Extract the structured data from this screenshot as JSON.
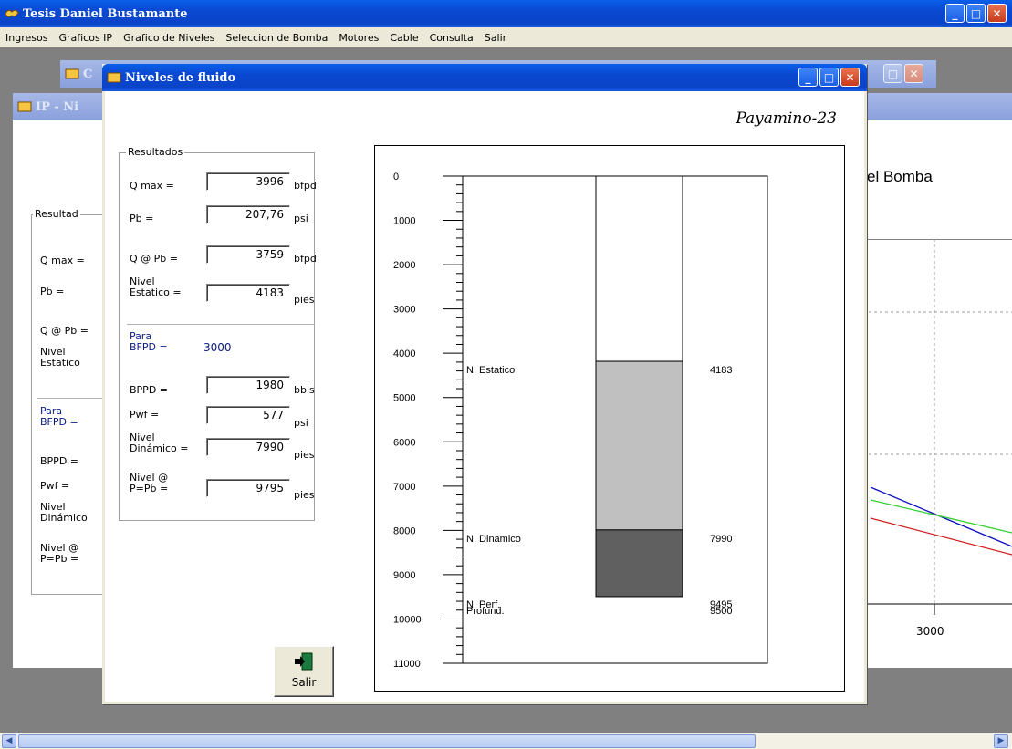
{
  "app": {
    "title": "Tesis Daniel Bustamante",
    "menu": [
      "Ingresos",
      "Graficos IP",
      "Grafico de Niveles",
      "Seleccion de Bomba",
      "Motores",
      "Cable",
      "Consulta",
      "Salir"
    ]
  },
  "bg_windows": {
    "win1_title": "C",
    "win2_title": "IP - Ni",
    "heading_fragment": "el Bomba",
    "axis_label_3000": "3000",
    "results_title": "Resultad",
    "labels": [
      "Q max =",
      "Pb =",
      "Q @ Pb =",
      "Nivel\nEstatico",
      "Para\nBFPD =",
      "BPPD =",
      "Pwf =",
      "Nivel\nDinámico",
      "Nivel @\nP=Pb ="
    ]
  },
  "dialog": {
    "title": "Niveles de fluido",
    "well_name": "Payamino-23",
    "results_title": "Resultados",
    "fields": {
      "qmax": {
        "label": "Q max =",
        "value": "3996",
        "unit": "bfpd"
      },
      "pb": {
        "label": "Pb =",
        "value": "207,76",
        "unit": "psi"
      },
      "qpb": {
        "label": "Q @ Pb =",
        "value": "3759",
        "unit": "bfpd"
      },
      "nivel_estatico": {
        "label_line1": "Nivel",
        "label_line2": "Estatico  =",
        "value": "4183",
        "unit": "pies"
      },
      "para_bfpd": {
        "label_line1": "Para",
        "label_line2": "BFPD  =",
        "value": "3000"
      },
      "bppd": {
        "label": "BPPD  =",
        "value": "1980",
        "unit": "bbls"
      },
      "pwf": {
        "label": "Pwf  =",
        "value": "577",
        "unit": "psi"
      },
      "nivel_dinamico": {
        "label_line1": "Nivel",
        "label_line2": "Dinámico =",
        "value": "7990",
        "unit": "pies"
      },
      "nivel_pb": {
        "label_line1": "Nivel @",
        "label_line2": "P=Pb =",
        "value": "9795",
        "unit": "pies"
      }
    },
    "salir_label": "Salir"
  },
  "levels_chart": {
    "depth_min": 0,
    "depth_max": 11000,
    "scale_labels": [
      "0",
      "1000",
      "2000",
      "3000",
      "4000",
      "5000",
      "6000",
      "7000",
      "8000",
      "9000",
      "10000",
      "11000"
    ],
    "estatico": {
      "label": "N. Estatico",
      "value_label": "4183",
      "depth": 4183
    },
    "dinamico": {
      "label": "N. Dinamico",
      "value_label": "7990",
      "depth": 7990
    },
    "perf": {
      "label": "N. Perf.",
      "value_label": "9495",
      "depth": 9495
    },
    "profund": {
      "label": "Profund.",
      "value_label": "9500",
      "depth": 9500
    },
    "colors": {
      "empty": "#ffffff",
      "fluid": "#c0c0c0",
      "dense": "#606060"
    }
  },
  "bg_chart_lines": {
    "colors": [
      "#1010c0",
      "#30d030",
      "#d02020"
    ]
  }
}
